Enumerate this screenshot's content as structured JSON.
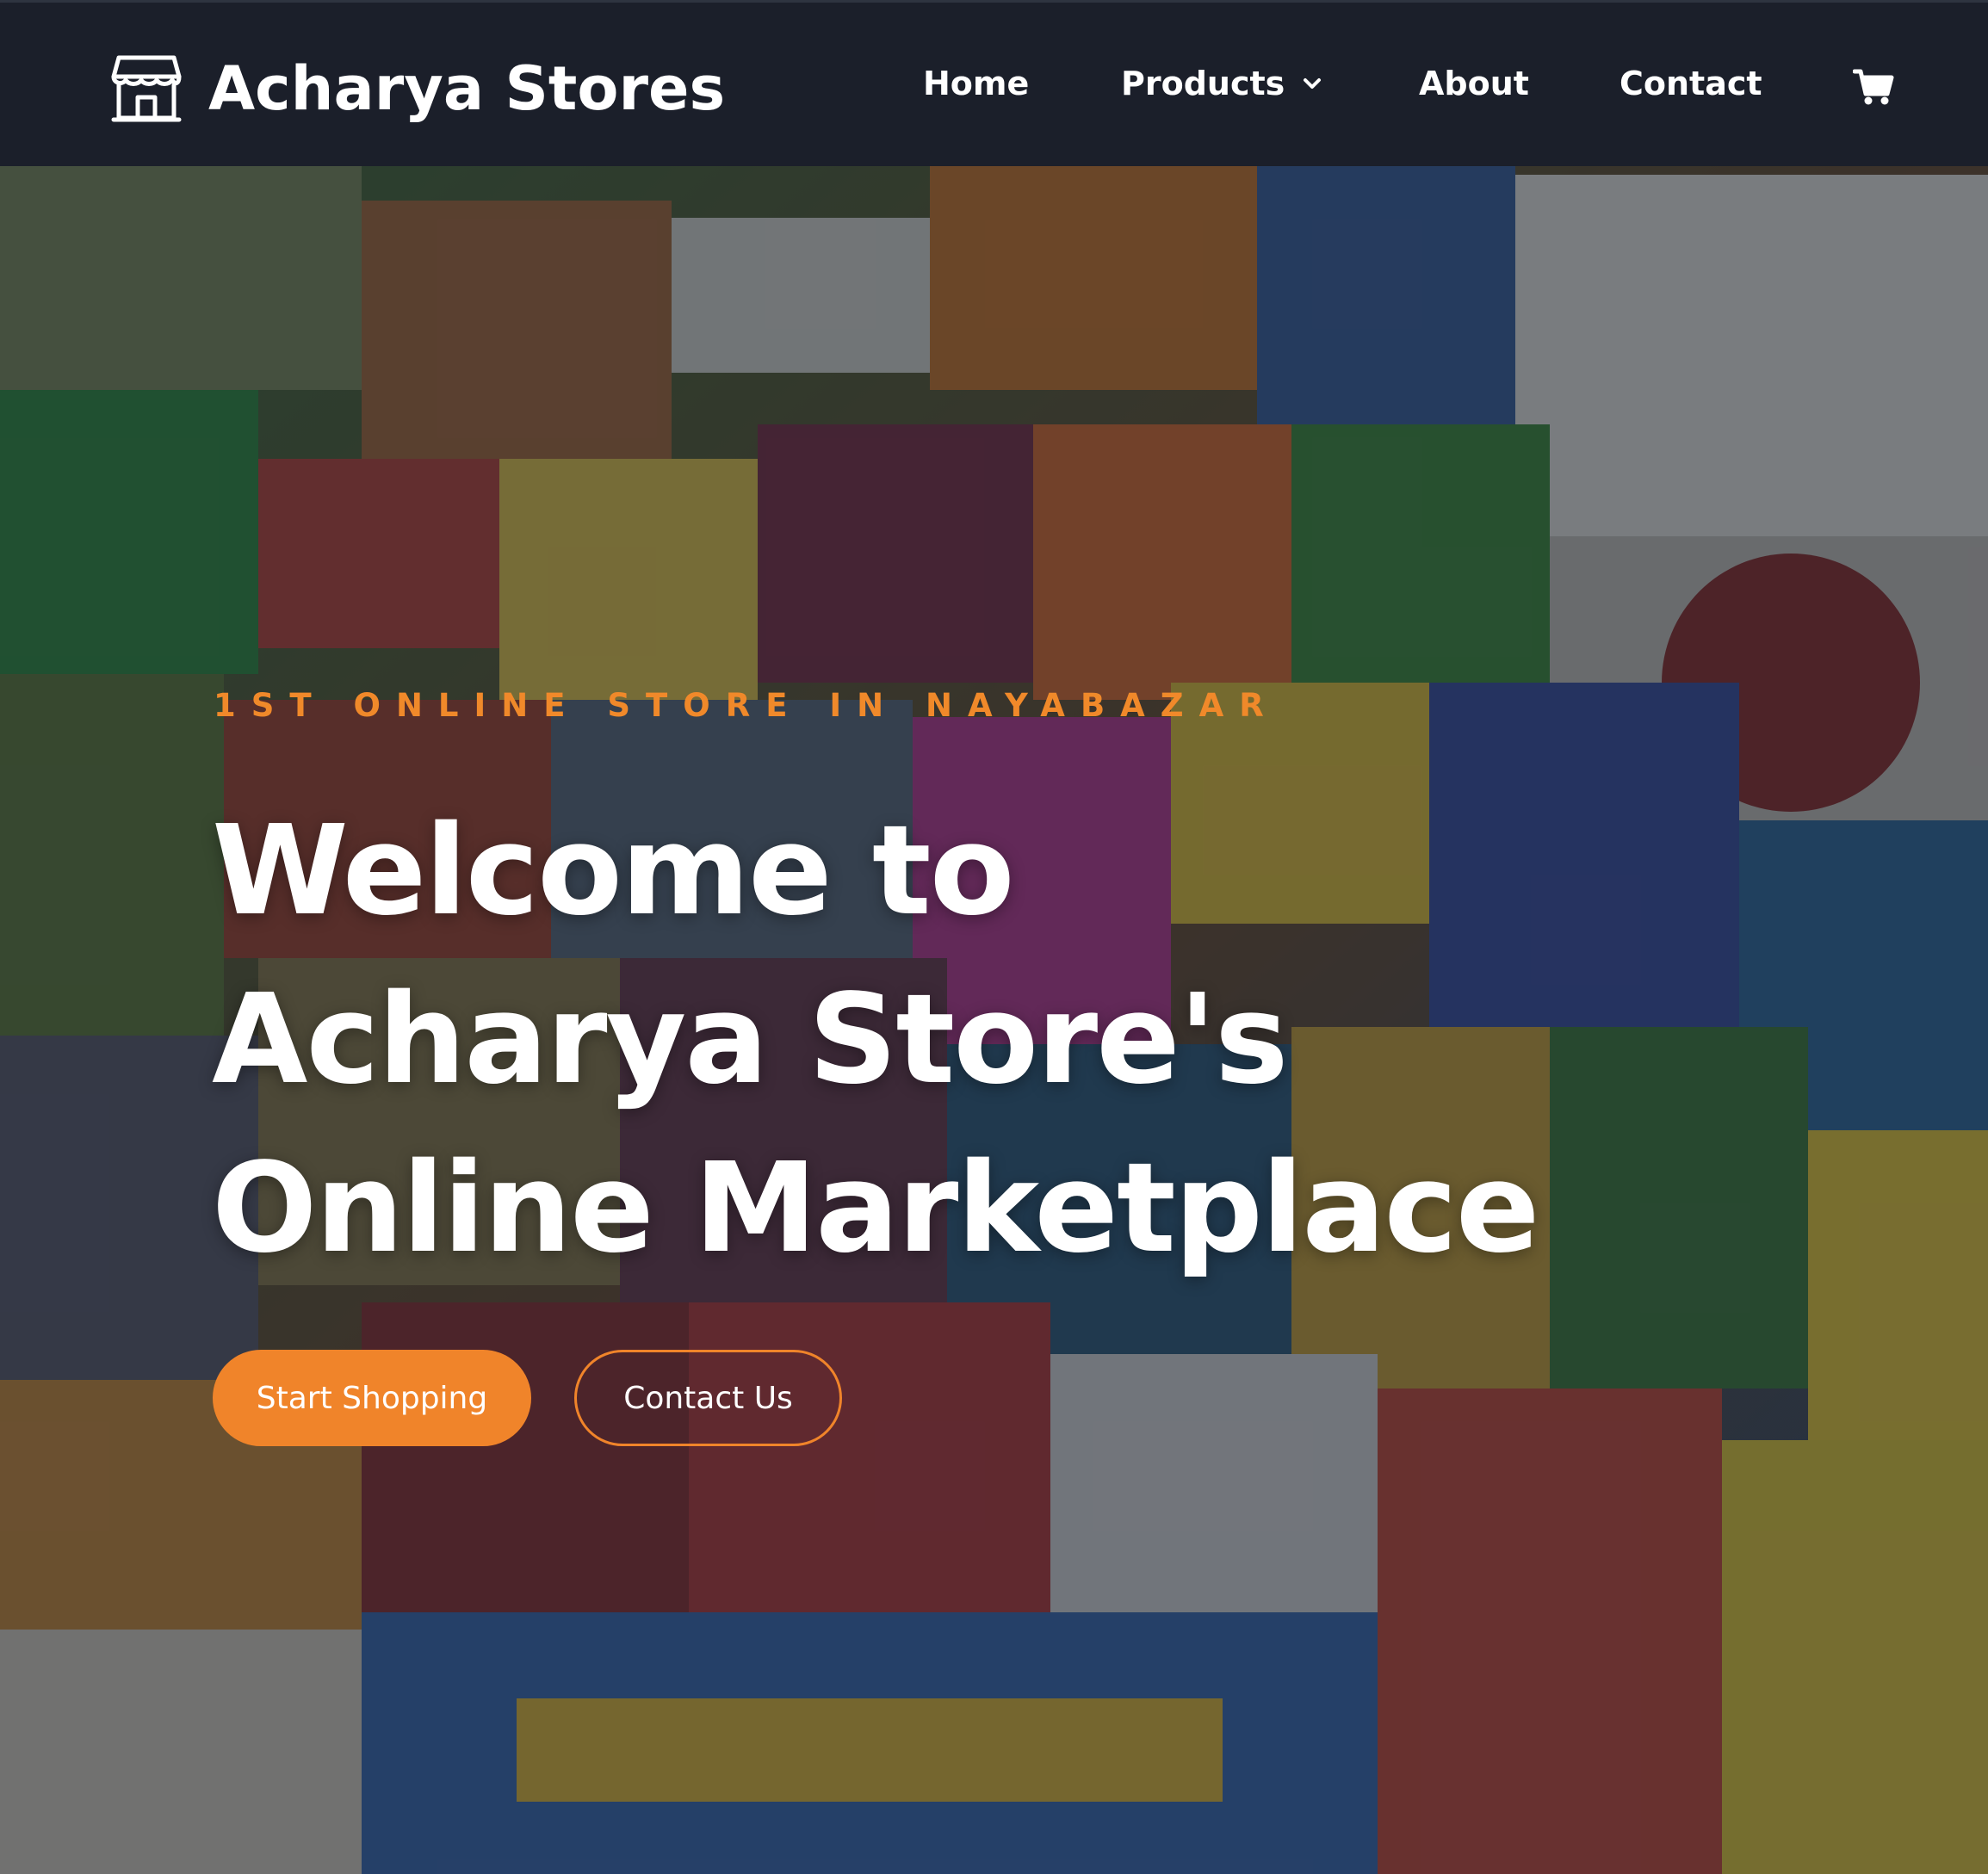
{
  "brand": {
    "name": "Acharya Stores",
    "icon": "storefront-icon"
  },
  "nav": {
    "home": "Home",
    "products": "Products",
    "products_icon": "chevron-down-icon",
    "about": "About",
    "contact": "Contact",
    "cart_icon": "shopping-cart-icon"
  },
  "hero": {
    "eyebrow": "1ST ONLINE STORE IN NAYABAZAR",
    "headline_lines": [
      "Welcome to",
      "Acharya Store's",
      "Online Marketplace"
    ],
    "primary_cta": "Start Shopping",
    "secondary_cta": "Contact Us",
    "background": "grocery-products-photo"
  },
  "colors": {
    "navbar_bg": "#1b1f2a",
    "accent": "#f0842a",
    "text": "#ffffff"
  }
}
